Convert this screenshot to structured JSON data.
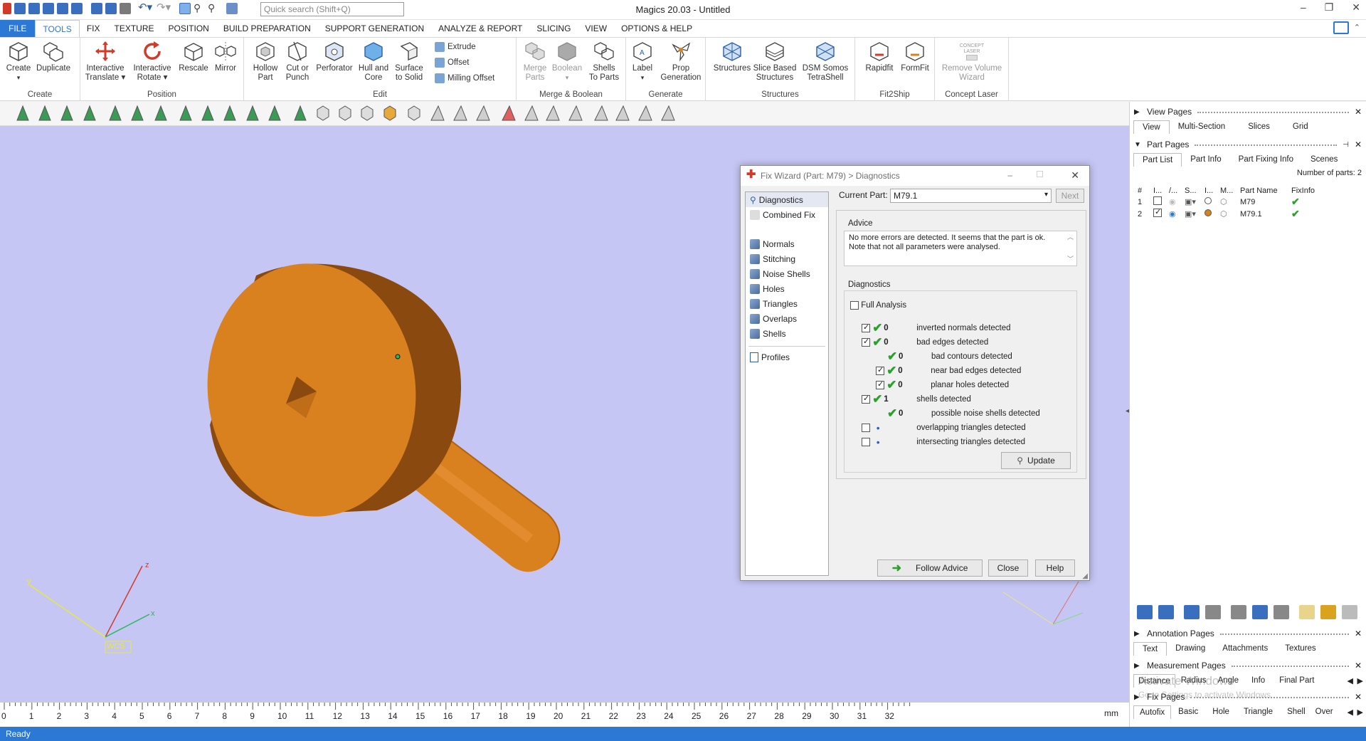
{
  "titlebar": {
    "title": "Magics 20.03 - Untitled",
    "search_placeholder": "Quick search (Shift+Q)"
  },
  "menu": [
    "FILE",
    "TOOLS",
    "FIX",
    "TEXTURE",
    "POSITION",
    "BUILD PREPARATION",
    "SUPPORT GENERATION",
    "ANALYZE & REPORT",
    "SLICING",
    "VIEW",
    "OPTIONS & HELP"
  ],
  "ribbon": {
    "create": {
      "label": "Create",
      "create": "Create",
      "duplicate": "Duplicate"
    },
    "position": {
      "label": "Position",
      "translate_1": "Interactive",
      "translate_2": "Translate",
      "rotate_1": "Interactive",
      "rotate_2": "Rotate",
      "rescale": "Rescale",
      "mirror": "Mirror"
    },
    "edit": {
      "label": "Edit",
      "hollow_1": "Hollow",
      "hollow_2": "Part",
      "cut_1": "Cut or",
      "cut_2": "Punch",
      "perforator": "Perforator",
      "hull_1": "Hull and",
      "hull_2": "Core",
      "surface_1": "Surface",
      "surface_2": "to Solid",
      "extrude": "Extrude",
      "offset": "Offset",
      "milling": "Milling Offset"
    },
    "merge": {
      "label": "Merge & Boolean",
      "merge_1": "Merge",
      "merge_2": "Parts",
      "boolean": "Boolean",
      "shells_1": "Shells",
      "shells_2": "To Parts"
    },
    "generate": {
      "label": "Generate",
      "label_btn": "Label",
      "prop_1": "Prop",
      "prop_2": "Generation"
    },
    "structures": {
      "label": "Structures",
      "structures": "Structures",
      "slice_1": "Slice Based",
      "slice_2": "Structures",
      "dsm_1": "DSM Somos",
      "dsm_2": "TetraShell"
    },
    "fit2ship": {
      "label": "Fit2Ship",
      "rapidfit": "Rapidfit",
      "formfit": "FormFit"
    },
    "concept": {
      "label": "Concept Laser",
      "logo_1": "CONCEPT",
      "logo_2": "LASER",
      "remove_1": "Remove Volume",
      "remove_2": "Wizard"
    }
  },
  "viewport": {
    "axis_x": "x",
    "axis_y": "y",
    "axis_z": "z",
    "wcs": "WCS",
    "ruler_unit": "mm",
    "ruler_ticks": [
      "0",
      "1",
      "2",
      "3",
      "4",
      "5",
      "6",
      "7",
      "8",
      "9",
      "10",
      "11",
      "12",
      "13",
      "14",
      "15",
      "16",
      "17",
      "18",
      "19",
      "20",
      "21",
      "22",
      "23",
      "24",
      "25",
      "26",
      "27",
      "28",
      "29",
      "30",
      "31",
      "32"
    ]
  },
  "dialog": {
    "title": "Fix Wizard (Part: M79) > Diagnostics",
    "nav": {
      "diagnostics": "Diagnostics",
      "combined": "Combined Fix",
      "normals": "Normals",
      "stitching": "Stitching",
      "noise": "Noise Shells",
      "holes": "Holes",
      "triangles": "Triangles",
      "overlaps": "Overlaps",
      "shells": "Shells",
      "profiles": "Profiles"
    },
    "current_part_label": "Current Part:",
    "current_part": "M79.1",
    "next": "Next",
    "advice_title": "Advice",
    "advice_line1": "No more errors are detected. It seems that the part is ok.",
    "advice_line2": "Note that not all parameters were analysed.",
    "diagnostics_title": "Diagnostics",
    "full_analysis": "Full Analysis",
    "items": [
      {
        "count": "0",
        "label": "inverted normals detected"
      },
      {
        "count": "0",
        "label": "bad edges detected"
      },
      {
        "count": "0",
        "label": "bad contours detected"
      },
      {
        "count": "0",
        "label": "near bad edges detected"
      },
      {
        "count": "0",
        "label": "planar holes detected"
      },
      {
        "count": "1",
        "label": "shells detected"
      },
      {
        "count": "0",
        "label": "possible noise shells detected"
      },
      {
        "count": "",
        "label": "overlapping triangles detected"
      },
      {
        "count": "",
        "label": "intersecting triangles detected"
      }
    ],
    "update": "Update",
    "follow_advice": "Follow Advice",
    "close": "Close",
    "help": "Help"
  },
  "rightpanel": {
    "view_pages": "View Pages",
    "view_tabs": [
      "View",
      "Multi-Section",
      "Slices",
      "Grid"
    ],
    "part_pages": "Part Pages",
    "part_tabs": [
      "Part List",
      "Part Info",
      "Part Fixing Info",
      "Scenes"
    ],
    "num_parts": "Number of parts: 2",
    "col_num": "#",
    "col_i": "I...",
    "col_slash": "/...",
    "col_s": "S...",
    "col_dots": "I...",
    "col_m": "M...",
    "col_name": "Part Name",
    "col_fix": "FixInfo",
    "parts": [
      {
        "num": "1",
        "name": "M79"
      },
      {
        "num": "2",
        "name": "M79.1"
      }
    ],
    "annotation_pages": "Annotation Pages",
    "annotation_tabs": [
      "Text",
      "Drawing",
      "Attachments",
      "Textures"
    ],
    "measurement_pages": "Measurement Pages",
    "measurement_tabs": [
      "Distance",
      "Radius",
      "Angle",
      "Info",
      "Final Part"
    ],
    "watermark_1": "Activate Windows",
    "watermark_2": "Go to Settings to activate Windows.",
    "fix_pages": "Fix Pages",
    "fix_tabs": [
      "Autofix",
      "Basic",
      "Hole",
      "Triangle",
      "Shell",
      "Over"
    ]
  },
  "status": "Ready",
  "colors": {
    "accent": "#2b79d4",
    "viewport": "#c6c6f5",
    "part": "#d9801f",
    "ok_green": "#2aa12a"
  }
}
